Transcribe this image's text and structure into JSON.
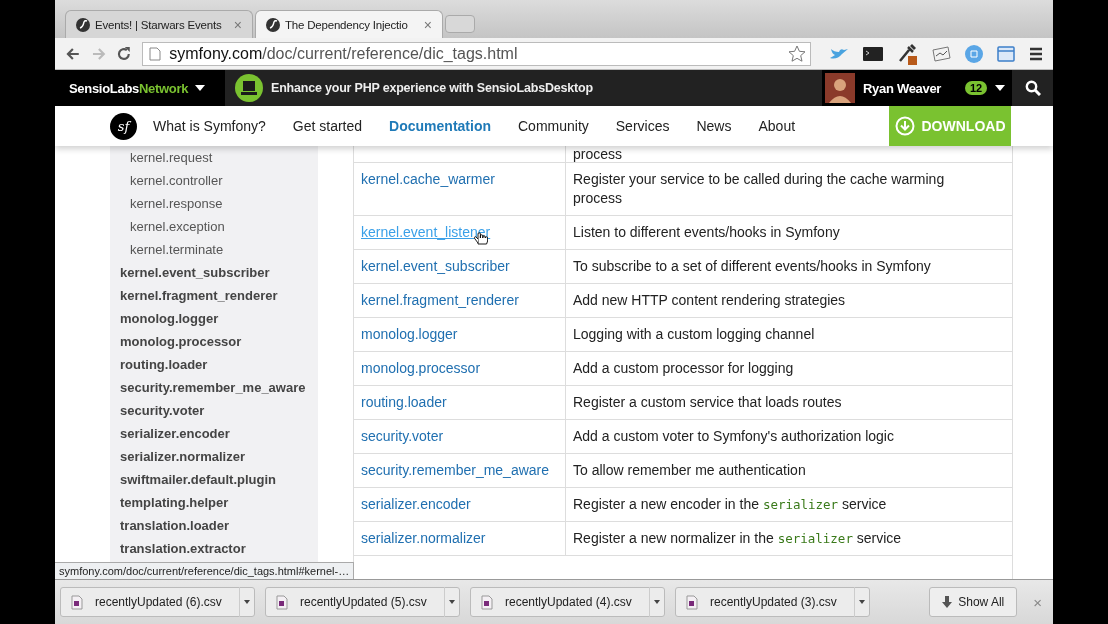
{
  "tabs": [
    {
      "title": "Events! | Starwars Events",
      "selected": false,
      "close": "×"
    },
    {
      "title": "The Dependency Injectio",
      "selected": true,
      "close": "×"
    }
  ],
  "toolbar": {
    "forward_disabled": true,
    "url_host": "symfony.com",
    "url_path": "/doc/current/reference/dic_tags.html"
  },
  "network_bar": {
    "brand_a": "SensioLabs",
    "brand_b": "Network",
    "promo": "Enhance your PHP experience with SensioLabsDesktop",
    "user": "Ryan Weaver",
    "badge": "12"
  },
  "site_nav": {
    "logo": "sf",
    "items": [
      {
        "label": "What is Symfony?",
        "selected": false
      },
      {
        "label": "Get started",
        "selected": false
      },
      {
        "label": "Documentation",
        "selected": true
      },
      {
        "label": "Community",
        "selected": false
      },
      {
        "label": "Services",
        "selected": false
      },
      {
        "label": "News",
        "selected": false
      },
      {
        "label": "About",
        "selected": false
      }
    ],
    "download": "DOWNLOAD"
  },
  "sidebar": {
    "sub_items": [
      "kernel.request",
      "kernel.controller",
      "kernel.response",
      "kernel.exception",
      "kernel.terminate"
    ],
    "items": [
      "kernel.event_subscriber",
      "kernel.fragment_renderer",
      "monolog.logger",
      "monolog.processor",
      "routing.loader",
      "security.remember_me_aware",
      "security.voter",
      "serializer.encoder",
      "serializer.normalizer",
      "swiftmailer.default.plugin",
      "templating.helper",
      "translation.loader",
      "translation.extractor"
    ]
  },
  "table": {
    "rows": [
      {
        "description": [
          {
            "kind": "text",
            "text": "process"
          }
        ]
      },
      {
        "tag": "kernel.cache_warmer",
        "hovered": false,
        "description": [
          {
            "kind": "text",
            "text": "Register your service to be called during the cache warming process"
          }
        ]
      },
      {
        "tag": "kernel.event_listener",
        "hovered": true,
        "description": [
          {
            "kind": "text",
            "text": "Listen to different events/hooks in Symfony"
          }
        ]
      },
      {
        "tag": "kernel.event_subscriber",
        "hovered": false,
        "description": [
          {
            "kind": "text",
            "text": "To subscribe to a set of different events/hooks in Symfony"
          }
        ]
      },
      {
        "tag": "kernel.fragment_renderer",
        "hovered": false,
        "description": [
          {
            "kind": "text",
            "text": "Add new HTTP content rendering strategies"
          }
        ]
      },
      {
        "tag": "monolog.logger",
        "hovered": false,
        "description": [
          {
            "kind": "text",
            "text": "Logging with a custom logging channel"
          }
        ]
      },
      {
        "tag": "monolog.processor",
        "hovered": false,
        "description": [
          {
            "kind": "text",
            "text": "Add a custom processor for logging"
          }
        ]
      },
      {
        "tag": "routing.loader",
        "hovered": false,
        "description": [
          {
            "kind": "text",
            "text": "Register a custom service that loads routes"
          }
        ]
      },
      {
        "tag": "security.voter",
        "hovered": false,
        "description": [
          {
            "kind": "text",
            "text": "Add a custom voter to Symfony's authorization logic"
          }
        ]
      },
      {
        "tag": "security.remember_me_aware",
        "hovered": false,
        "description": [
          {
            "kind": "text",
            "text": "To allow remember me authentication"
          }
        ]
      },
      {
        "tag": "serializer.encoder",
        "hovered": false,
        "description": [
          {
            "kind": "text",
            "text": "Register a new encoder in the "
          },
          {
            "kind": "code",
            "text": "serializer"
          },
          {
            "kind": "text",
            "text": " service"
          }
        ]
      },
      {
        "tag": "serializer.normalizer",
        "hovered": false,
        "description": [
          {
            "kind": "text",
            "text": "Register a new normalizer in the "
          },
          {
            "kind": "code",
            "text": "serializer"
          },
          {
            "kind": "text",
            "text": " service"
          }
        ]
      }
    ]
  },
  "status_url": "symfony.com/doc/current/reference/dic_tags.html#kernel-…",
  "downloads": {
    "items": [
      "recentlyUpdated (6).csv",
      "recentlyUpdated (5).csv",
      "recentlyUpdated (4).csv",
      "recentlyUpdated (3).csv"
    ],
    "show_all": "Show All",
    "close": "×"
  }
}
